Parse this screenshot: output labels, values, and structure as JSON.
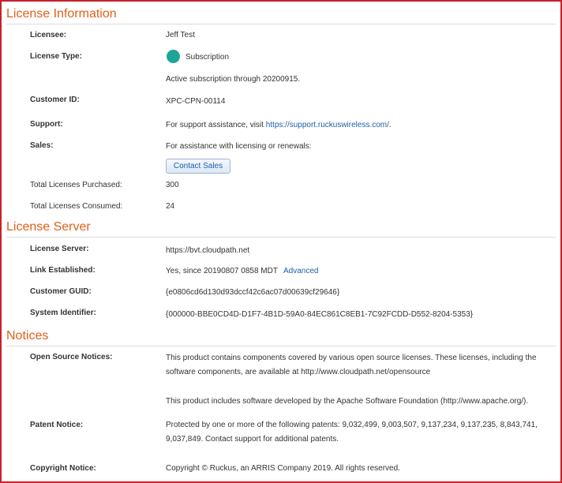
{
  "sections": {
    "license_information": "License Information",
    "license_server": "License Server",
    "notices": "Notices"
  },
  "license_info": {
    "licensee_label": "Licensee:",
    "licensee_value": "Jeff Test",
    "license_type_label": "License Type:",
    "license_type_value": "Subscription",
    "subscription_note": "Active subscription through 20200915.",
    "customer_id_label": "Customer ID:",
    "customer_id_value": "XPC-CPN-00114",
    "support_label": "Support:",
    "support_prefix": "For support assistance, visit ",
    "support_link": "https://support.ruckuswireless.com/",
    "support_suffix": ".",
    "sales_label": "Sales:",
    "sales_value": "For assistance with licensing or renewals:",
    "contact_sales_button": "Contact Sales",
    "total_purchased_label": "Total Licenses Purchased:",
    "total_purchased_value": "300",
    "total_consumed_label": "Total Licenses Consumed:",
    "total_consumed_value": "24"
  },
  "license_server": {
    "server_label": "License Server:",
    "server_value": "https://bvt.cloudpath.net",
    "link_label": "Link Established:",
    "link_value": "Yes, since 20190807 0858 MDT",
    "advanced_link": "Advanced",
    "guid_label": "Customer GUID:",
    "guid_value": "{e0806cd6d130d93dccf42c6ac07d00639cf29646}",
    "system_id_label": "System Identifier:",
    "system_id_value": "{000000-BBE0CD4D-D1F7-4B1D-59A0-84EC861C8EB1-7C92FCDD-D552-8204-5353}"
  },
  "notices": {
    "open_source_label": "Open Source Notices:",
    "open_source_text1": "This product contains components covered by various open source licenses. These licenses, including the software components, are available at http://www.cloudpath.net/opensource",
    "open_source_text2": "This product includes software developed by the Apache Software Foundation (http://www.apache.org/).",
    "patent_label": "Patent Notice:",
    "patent_text": "Protected by one or more of the following patents: 9,032,499, 9,003,507, 9,137,234, 9,137,235, 8,843,741, 9,037,849. Contact support for additional patents.",
    "copyright_label": "Copyright Notice:",
    "copyright_text": "Copyright © Ruckus, an ARRIS Company 2019. All rights reserved."
  },
  "colors": {
    "section_title": "#e0601a",
    "border": "#c8202a",
    "link": "#1f5fa8",
    "subscription_badge": "#1ea59a"
  },
  "icons": {
    "subscription_badge": "subscription-status-icon"
  }
}
